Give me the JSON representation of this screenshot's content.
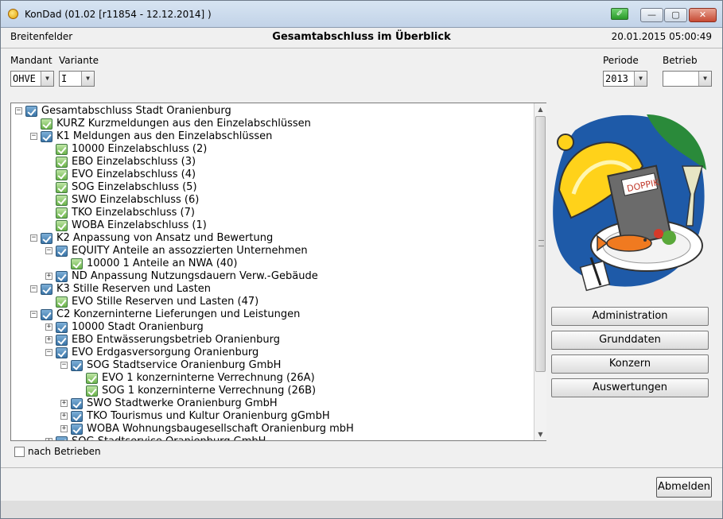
{
  "window": {
    "title": "KonDad (01.02 [r11854 - 12.12.2014] )",
    "controls": {
      "special": "✐",
      "minimize": "—",
      "maximize": "▢",
      "close": "✕"
    }
  },
  "header": {
    "left": "Breitenfelder",
    "center": "Gesamtabschluss im Überblick",
    "right": "20.01.2015 05:00:49"
  },
  "filters": {
    "mandant_label": "Mandant",
    "mandant_value": "OHVE",
    "variante_label": "Variante",
    "variante_value": "I",
    "periode_label": "Periode",
    "periode_value": "2013",
    "betrieb_label": "Betrieb",
    "betrieb_value": ""
  },
  "tree": [
    {
      "expander": "−",
      "text": "Gesamtabschluss Stadt Oranienburg"
    },
    {
      "expander": "",
      "text": "KURZ Kurzmeldungen aus den Einzelabschlüssen"
    },
    {
      "expander": "−",
      "text": "K1 Meldungen aus den Einzelabschlüssen"
    },
    {
      "expander": "",
      "text": "10000 Einzelabschluss (2)"
    },
    {
      "expander": "",
      "text": "EBO Einzelabschluss (3)"
    },
    {
      "expander": "",
      "text": "EVO Einzelabschluss (4)"
    },
    {
      "expander": "",
      "text": "SOG Einzelabschluss (5)"
    },
    {
      "expander": "",
      "text": "SWO Einzelabschluss (6)"
    },
    {
      "expander": "",
      "text": "TKO Einzelabschluss (7)"
    },
    {
      "expander": "",
      "text": "WOBA Einzelabschluss (1)"
    },
    {
      "expander": "−",
      "text": "K2 Anpassung von Ansatz und Bewertung"
    },
    {
      "expander": "−",
      "text": "EQUITY Anteile an assozzierten Unternehmen"
    },
    {
      "expander": "",
      "text": "10000 1 Anteile an NWA (40)"
    },
    {
      "expander": "+",
      "text": "ND Anpassung Nutzungsdauern Verw.-Gebäude"
    },
    {
      "expander": "−",
      "text": "K3 Stille Reserven und Lasten"
    },
    {
      "expander": "",
      "text": "EVO Stille Reserven und Lasten (47)"
    },
    {
      "expander": "−",
      "text": "C2 Konzerninterne Lieferungen und Leistungen"
    },
    {
      "expander": "+",
      "text": "10000 Stadt Oranienburg"
    },
    {
      "expander": "+",
      "text": "EBO Entwässerungsbetrieb Oranienburg"
    },
    {
      "expander": "−",
      "text": "EVO Erdgasversorgung Oranienburg"
    },
    {
      "expander": "−",
      "text": "SOG Stadtservice Oranienburg GmbH"
    },
    {
      "expander": "",
      "text": "EVO 1 konzerninterne Verrechnung (26A)"
    },
    {
      "expander": "",
      "text": "SOG 1 konzerninterne Verrechnung (26B)"
    },
    {
      "expander": "+",
      "text": "SWO Stadtwerke Oranienburg GmbH"
    },
    {
      "expander": "+",
      "text": "TKO Tourismus und Kultur Oranienburg gGmbH"
    },
    {
      "expander": "+",
      "text": "WOBA Wohnungsbaugesellschaft Oranienburg mbH"
    },
    {
      "expander": "+",
      "text": "SOG Stadtservice Oranienburg GmbH"
    }
  ],
  "scrollbar": {
    "up": "▲",
    "down": "▼"
  },
  "checkbox": {
    "label": "nach Betrieben"
  },
  "illustration": {
    "label": "DOPPIK"
  },
  "nav_buttons": {
    "administration": "Administration",
    "grunddaten": "Grunddaten",
    "konzern": "Konzern",
    "auswertungen": "Auswertungen"
  },
  "footer": {
    "abmelden": "Abmelden"
  }
}
